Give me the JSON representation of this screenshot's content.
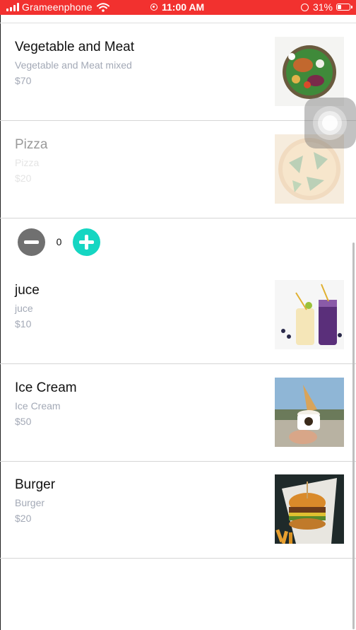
{
  "status_bar": {
    "carrier": "Grameenphone",
    "time": "11:00 AM",
    "battery": "31%",
    "background_color": "#f2312f"
  },
  "items": [
    {
      "name": "Vegetable and Meat",
      "description": "Vegetable and Meat mixed",
      "price": "$70",
      "image": "salad-bowl-photo"
    },
    {
      "name": "Pizza",
      "description": "Pizza",
      "price": "$20",
      "image": "pizza-photo"
    },
    {
      "name": "juce",
      "description": "juce",
      "price": "$10",
      "image": "juice-glasses-photo"
    },
    {
      "name": "Ice Cream",
      "description": "Ice Cream",
      "price": "$50",
      "image": "ice-cream-cone-photo"
    },
    {
      "name": "Burger",
      "description": "Burger",
      "price": "$20",
      "image": "burger-fries-photo"
    }
  ],
  "stepper": {
    "quantity": "0",
    "minus_icon": "minus-circle-icon",
    "plus_icon": "plus-circle-icon",
    "plus_color": "#15d6c2",
    "minus_color": "#707070"
  }
}
